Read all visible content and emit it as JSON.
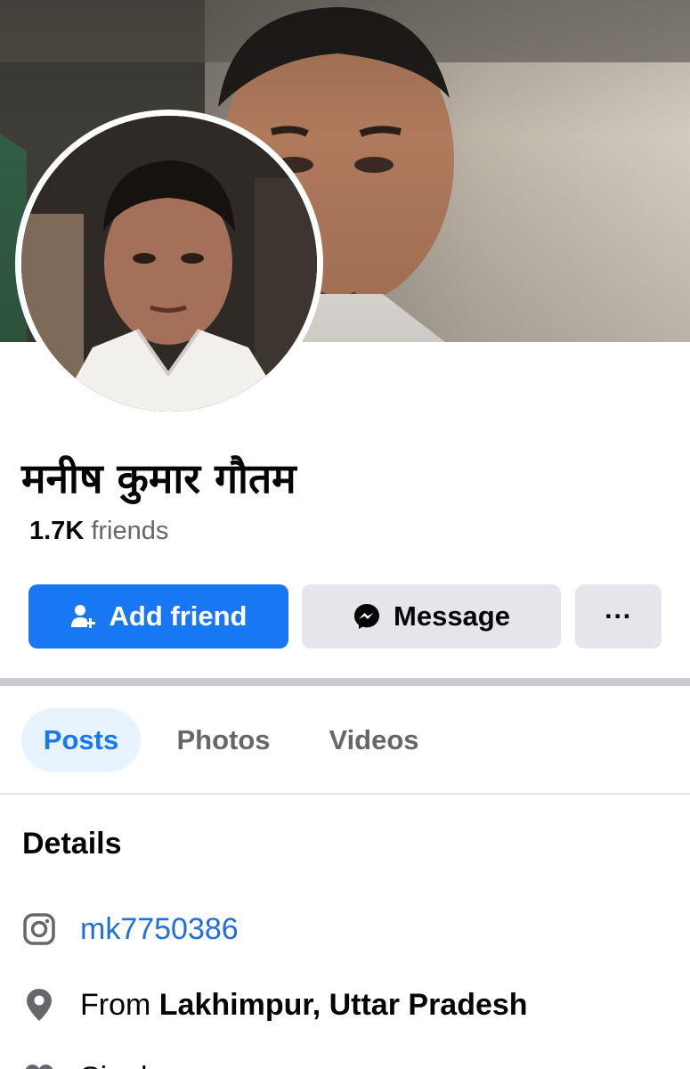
{
  "profile": {
    "name": "मनीष कुमार गौतम",
    "friends_count": "1.7K",
    "friends_label": "friends"
  },
  "actions": {
    "add_friend_label": "Add friend",
    "message_label": "Message",
    "more_label": "···"
  },
  "tabs": [
    {
      "label": "Posts",
      "active": true
    },
    {
      "label": "Photos",
      "active": false
    },
    {
      "label": "Videos",
      "active": false
    }
  ],
  "details": {
    "title": "Details",
    "instagram": "mk7750386",
    "from_prefix": "From",
    "from_place": "Lakhimpur, Uttar Pradesh",
    "relationship": "Single"
  },
  "icons": {
    "add_friend": "person-plus-icon",
    "message": "messenger-icon",
    "more": "more-dots-icon",
    "instagram": "instagram-icon",
    "location": "location-pin-icon",
    "relationship": "heart-icon"
  },
  "colors": {
    "primary": "#1877f2",
    "secondary_bg": "#e4e6eb",
    "link": "#216fdb",
    "muted_text": "#65676b"
  }
}
